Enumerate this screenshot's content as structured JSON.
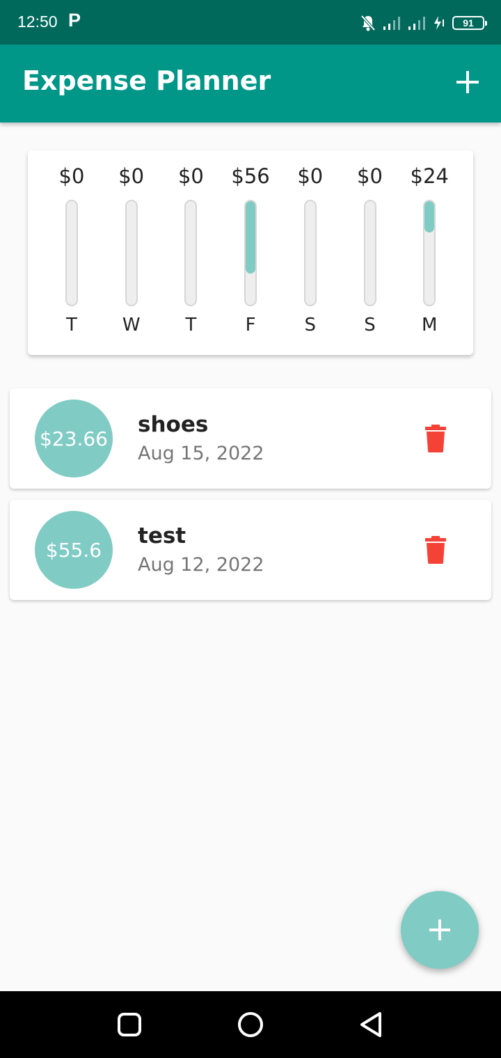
{
  "status_bar": {
    "time": "12:50",
    "notification_app": "P",
    "battery": "91",
    "icons": [
      "bell-off-icon",
      "signal-icon",
      "signal-icon",
      "charging-icon"
    ]
  },
  "app_bar": {
    "title": "Expense Planner",
    "add_icon": "plus-icon"
  },
  "chart_data": {
    "type": "bar",
    "categories": [
      "T",
      "W",
      "T",
      "F",
      "S",
      "S",
      "M"
    ],
    "value_labels": [
      "$0",
      "$0",
      "$0",
      "$56",
      "$0",
      "$0",
      "$24"
    ],
    "values": [
      0,
      0,
      0,
      55.6,
      0,
      0,
      23.66
    ],
    "fill_fraction": [
      0,
      0,
      0,
      0.7,
      0,
      0,
      0.3
    ],
    "ylim": [
      0,
      79.26
    ]
  },
  "transactions": [
    {
      "amount": "$23.66",
      "title": "shoes",
      "date": "Aug 15, 2022",
      "delete_icon": "trash-icon"
    },
    {
      "amount": "$55.6",
      "title": "test",
      "date": "Aug 12, 2022",
      "delete_icon": "trash-icon"
    }
  ],
  "fab": {
    "icon": "plus-icon"
  },
  "nav_bar": {
    "icons": [
      "recents-square-icon",
      "home-circle-icon",
      "back-triangle-icon"
    ]
  },
  "colors": {
    "status_bar": "#00695c",
    "primary": "#009688",
    "accent": "#80cbc4",
    "delete": "#f44336"
  }
}
